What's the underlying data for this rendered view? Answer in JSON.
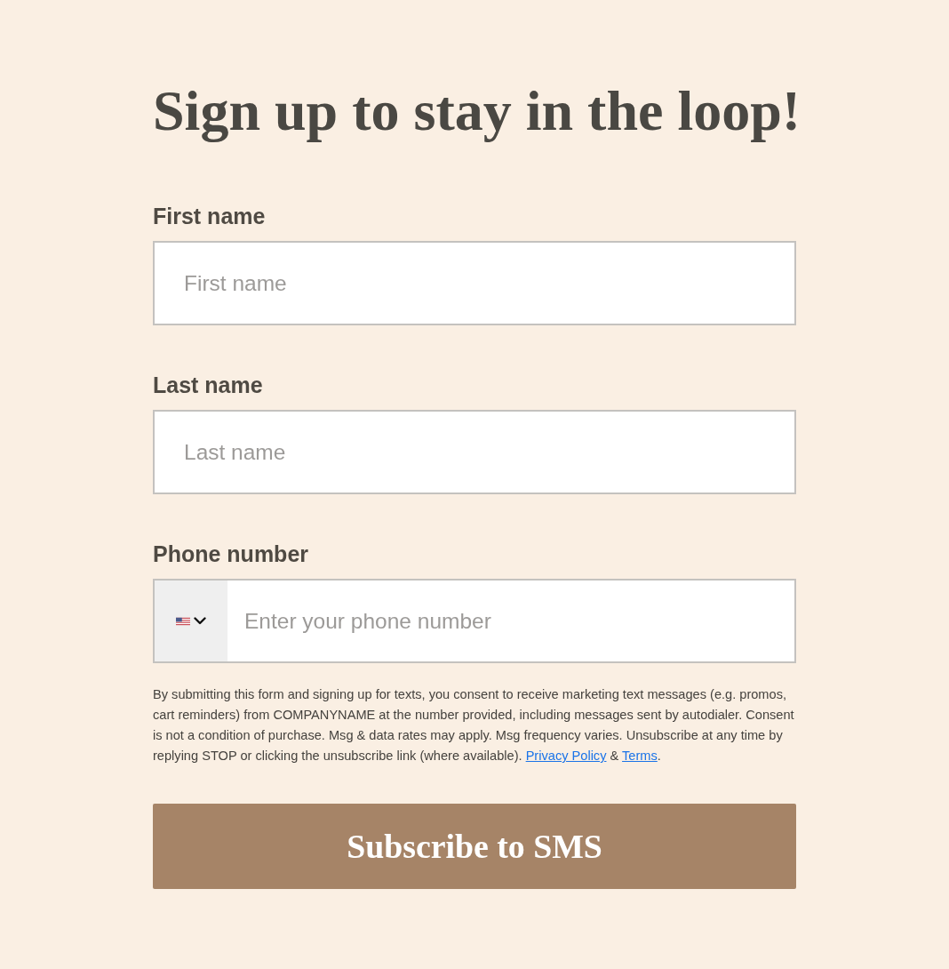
{
  "title": "Sign up to stay in the loop!",
  "fields": [
    {
      "kind": "text",
      "label": "First name",
      "placeholder": "First name"
    },
    {
      "kind": "text",
      "label": "Last name",
      "placeholder": "Last name"
    },
    {
      "kind": "phone",
      "label": "Phone number",
      "placeholder": "Enter your phone number"
    }
  ],
  "disclaimer": [
    {
      "kind": "text",
      "text": "By submitting this form and signing up for texts, you consent to receive marketing text messages (e.g. promos, cart reminders) from COMPANYNAME at the number provided, including messages sent by autodialer. Consent is not a condition of purchase. Msg & data rates may apply. Msg frequency varies. Unsubscribe at any time by replying STOP or clicking the unsubscribe link (where available). "
    },
    {
      "kind": "link",
      "text": "Privacy Policy"
    },
    {
      "kind": "text",
      "text": " & "
    },
    {
      "kind": "link",
      "text": "Terms"
    },
    {
      "kind": "text",
      "text": "."
    }
  ],
  "submit": {
    "label": "Subscribe to SMS"
  }
}
